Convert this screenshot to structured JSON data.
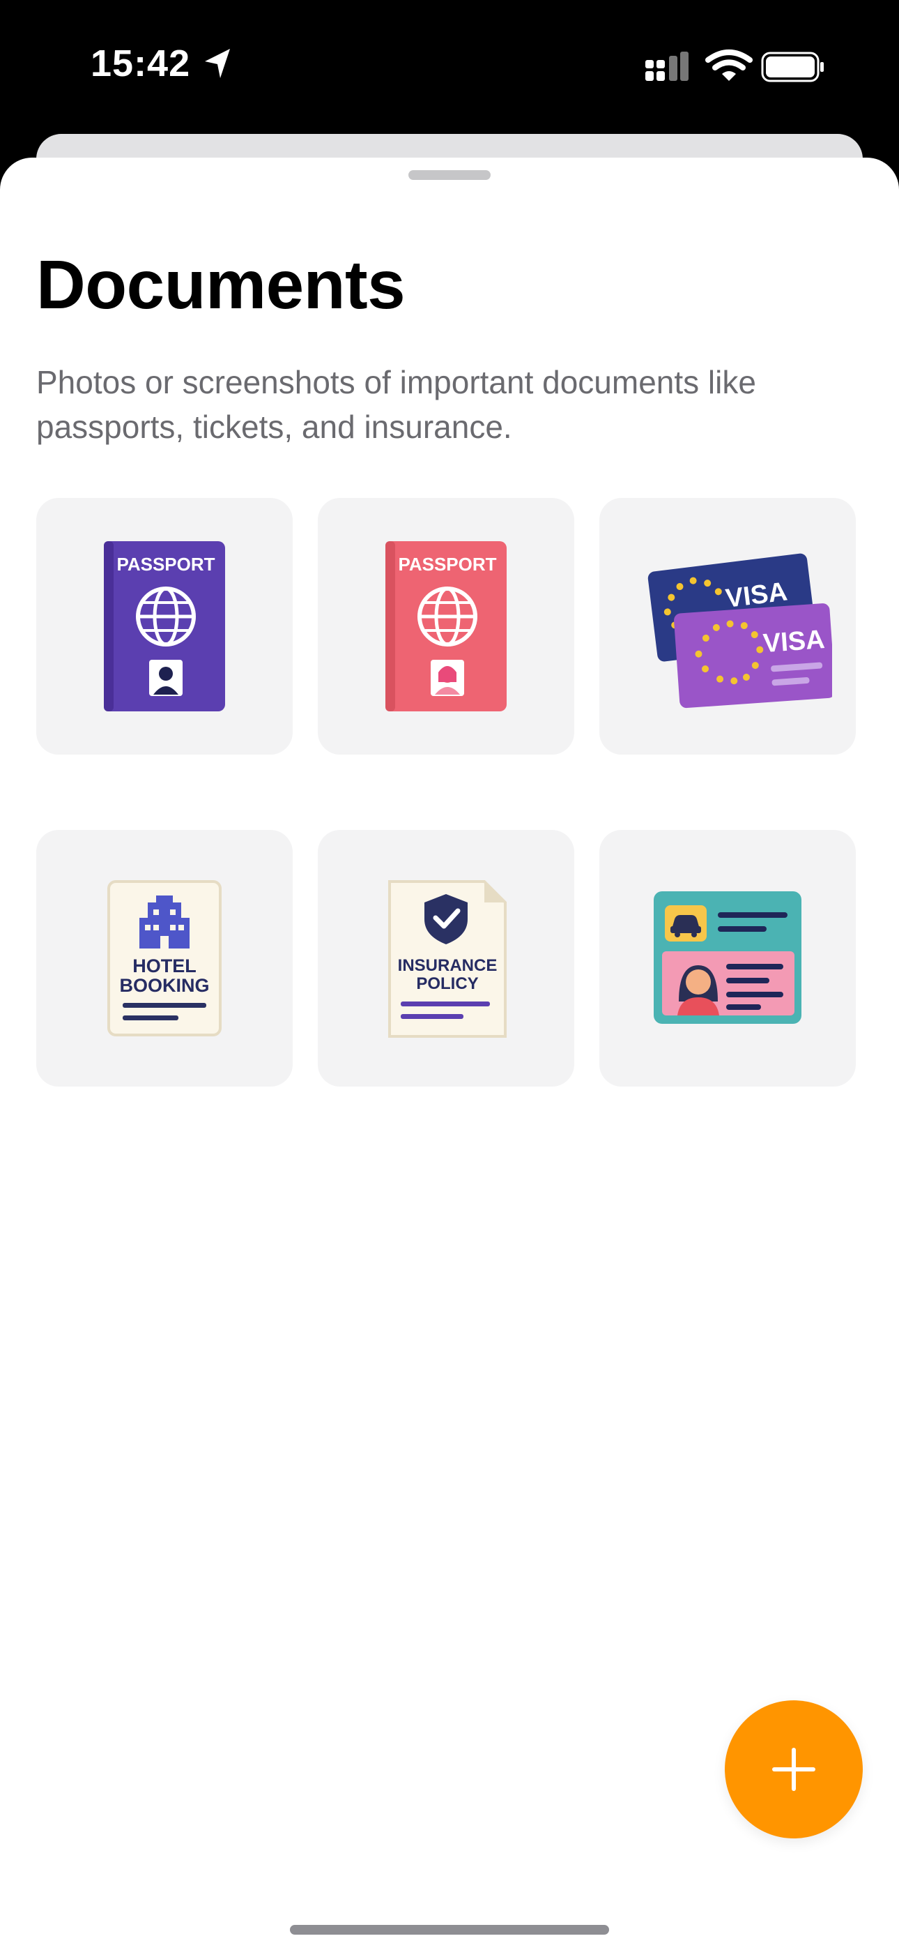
{
  "status_bar": {
    "time": "15:42",
    "icons": [
      "location-arrow-icon",
      "cellular-signal-icon",
      "wifi-icon",
      "battery-icon"
    ]
  },
  "sheet": {
    "title": "Documents",
    "subtitle": "Photos or screenshots of important documents like passports, tickets, and insurance."
  },
  "documents": [
    {
      "name": "purple-passport",
      "icon": "passport-icon",
      "label": "PASSPORT",
      "color": "#5b3fb0"
    },
    {
      "name": "pink-passport",
      "icon": "passport-icon",
      "label": "PASSPORT",
      "color": "#ee6472"
    },
    {
      "name": "visa-cards",
      "icon": "visa-card-icon",
      "labels": [
        "VISA",
        "VISA"
      ],
      "colors": [
        "#2a3a86",
        "#9a55c8"
      ]
    },
    {
      "name": "hotel-booking",
      "icon": "hotel-building-icon",
      "label_line1": "HOTEL",
      "label_line2": "BOOKING",
      "color": "#3b3f8f"
    },
    {
      "name": "insurance-policy",
      "icon": "shield-check-icon",
      "label_line1": "INSURANCE",
      "label_line2": "POLICY",
      "color": "#2a3163"
    },
    {
      "name": "driver-license",
      "icon": "id-card-icon",
      "color": "#4bb3b3"
    }
  ],
  "fab": {
    "icon": "plus-icon",
    "color": "#ff9500"
  }
}
